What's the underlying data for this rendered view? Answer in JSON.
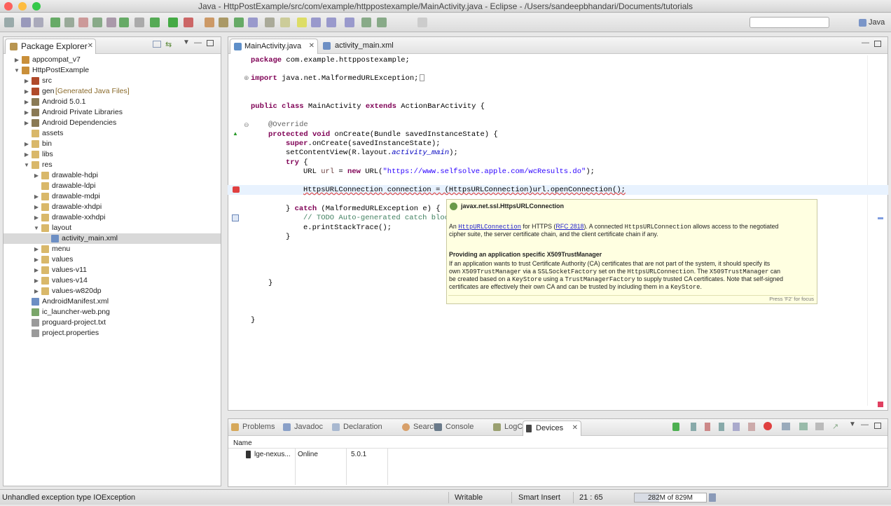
{
  "window": {
    "title": "Java - HttpPostExample/src/com/example/httppostexample/MainActivity.java - Eclipse - /Users/sandeepbhandari/Documents/tutorials"
  },
  "toolbar": {
    "perspective": "Java"
  },
  "package_explorer": {
    "title": "Package Explorer",
    "items": [
      {
        "label": "appcompat_v7",
        "depth": 0,
        "twisty": "▶",
        "icon": "project-icon",
        "color": "#c98f3a"
      },
      {
        "label": "HttpPostExample",
        "depth": 0,
        "twisty": "▼",
        "icon": "project-icon",
        "color": "#c98f3a"
      },
      {
        "label": "src",
        "depth": 1,
        "twisty": "▶",
        "icon": "source-folder-icon",
        "color": "#b04a2a"
      },
      {
        "label": "gen",
        "suffix": " [Generated Java Files]",
        "depth": 1,
        "twisty": "▶",
        "icon": "source-folder-icon",
        "color": "#b04a2a"
      },
      {
        "label": "Android 5.0.1",
        "depth": 1,
        "twisty": "▶",
        "icon": "library-icon",
        "color": "#8a7a55"
      },
      {
        "label": "Android Private Libraries",
        "depth": 1,
        "twisty": "▶",
        "icon": "library-icon",
        "color": "#8a7a55"
      },
      {
        "label": "Android Dependencies",
        "depth": 1,
        "twisty": "▶",
        "icon": "library-icon",
        "color": "#8a7a55"
      },
      {
        "label": "assets",
        "depth": 1,
        "twisty": "",
        "icon": "folder-icon",
        "color": "#d9b86a"
      },
      {
        "label": "bin",
        "depth": 1,
        "twisty": "▶",
        "icon": "folder-icon",
        "color": "#d9b86a"
      },
      {
        "label": "libs",
        "depth": 1,
        "twisty": "▶",
        "icon": "folder-icon",
        "color": "#d9b86a"
      },
      {
        "label": "res",
        "depth": 1,
        "twisty": "▼",
        "icon": "folder-icon",
        "color": "#d9b86a"
      },
      {
        "label": "drawable-hdpi",
        "depth": 2,
        "twisty": "▶",
        "icon": "folder-icon",
        "color": "#d9b86a"
      },
      {
        "label": "drawable-ldpi",
        "depth": 2,
        "twisty": "",
        "icon": "folder-icon",
        "color": "#d9b86a"
      },
      {
        "label": "drawable-mdpi",
        "depth": 2,
        "twisty": "▶",
        "icon": "folder-icon",
        "color": "#d9b86a"
      },
      {
        "label": "drawable-xhdpi",
        "depth": 2,
        "twisty": "▶",
        "icon": "folder-icon",
        "color": "#d9b86a"
      },
      {
        "label": "drawable-xxhdpi",
        "depth": 2,
        "twisty": "▶",
        "icon": "folder-icon",
        "color": "#d9b86a"
      },
      {
        "label": "layout",
        "depth": 2,
        "twisty": "▼",
        "icon": "folder-icon",
        "color": "#d9b86a"
      },
      {
        "label": "activity_main.xml",
        "depth": 3,
        "twisty": "",
        "icon": "xml-file-icon",
        "color": "#6d8fc4",
        "selected": true
      },
      {
        "label": "menu",
        "depth": 2,
        "twisty": "▶",
        "icon": "folder-icon",
        "color": "#d9b86a"
      },
      {
        "label": "values",
        "depth": 2,
        "twisty": "▶",
        "icon": "folder-icon",
        "color": "#d9b86a"
      },
      {
        "label": "values-v11",
        "depth": 2,
        "twisty": "▶",
        "icon": "folder-icon",
        "color": "#d9b86a"
      },
      {
        "label": "values-v14",
        "depth": 2,
        "twisty": "▶",
        "icon": "folder-icon",
        "color": "#d9b86a"
      },
      {
        "label": "values-w820dp",
        "depth": 2,
        "twisty": "▶",
        "icon": "folder-icon",
        "color": "#d9b86a"
      },
      {
        "label": "AndroidManifest.xml",
        "depth": 1,
        "twisty": "",
        "icon": "xml-file-icon",
        "color": "#6d8fc4"
      },
      {
        "label": "ic_launcher-web.png",
        "depth": 1,
        "twisty": "",
        "icon": "image-file-icon",
        "color": "#7aa66a"
      },
      {
        "label": "proguard-project.txt",
        "depth": 1,
        "twisty": "",
        "icon": "text-file-icon",
        "color": "#9a9a9a"
      },
      {
        "label": "project.properties",
        "depth": 1,
        "twisty": "",
        "icon": "text-file-icon",
        "color": "#9a9a9a"
      }
    ]
  },
  "editor": {
    "tabs": [
      "MainActivity.java",
      "activity_main.xml"
    ],
    "code": {
      "package": "package com.example.httppostexample;",
      "import": "import java.net.MalformedURLException;",
      "class_line": [
        "public class ",
        "MainActivity ",
        "extends ",
        "ActionBarActivity {"
      ],
      "override": "@Override",
      "oncreate": [
        "protected void ",
        "onCreate(Bundle savedInstanceState) {"
      ],
      "super": [
        "super",
        ".onCreate(savedInstanceState);"
      ],
      "setcontent": [
        "setContentView(R.layout.",
        "activity_main",
        ");"
      ],
      "try": [
        "try",
        " {"
      ],
      "url": [
        "URL ",
        "url",
        " = ",
        "new ",
        "URL(",
        "\"https://www.selfsolve.apple.com/wcResults.do\"",
        ");"
      ],
      "conn": "HttpsURLConnection connection = (HttpsURLConnection)url.openConnection();",
      "catch": [
        "} ",
        "catch ",
        "(MalformedURLException e) {"
      ],
      "todo": "// TODO Auto-generated catch block",
      "stack": "e.printStackTrace();",
      "brace1": "}",
      "brace2": "}",
      "brace3": "}"
    }
  },
  "tooltip": {
    "title": "javax.net.ssl.HttpsURLConnection",
    "p1_a": "An ",
    "p1_link": "HttpURLConnection",
    "p1_b": " for HTTPS (",
    "p1_rfc": "RFC 2818",
    "p1_c": "). A connected ",
    "p1_mono": "HttpsURLConnection",
    "p1_d": " allows access to the negotiated",
    "p1_e": "cipher suite, the server certificate chain, and the client certificate chain if any.",
    "h2": "Providing an application specific X509TrustManager",
    "p2_l1": "If an application wants to trust Certificate Authority (CA) certificates that are not part of the system, it should specify its",
    "p2_l2a": "own ",
    "p2_l2m1": "X509TrustManager",
    "p2_l2b": " via a ",
    "p2_l2m2": "SSLSocketFactory",
    "p2_l2c": " set on the ",
    "p2_l2m3": "HttpsURLConnection",
    "p2_l2d": ". The ",
    "p2_l2m4": "X509TrustManager",
    "p2_l2e": " can",
    "p2_l3a": "be created based on a ",
    "p2_l3m1": "KeyStore",
    "p2_l3b": " using a ",
    "p2_l3m2": "TrustManagerFactory",
    "p2_l3c": " to supply trusted CA certificates. Note that self-signed",
    "p2_l4a": "certificates are effectively their own CA and can be trusted by including them in a ",
    "p2_l4m": "KeyStore",
    "p2_l4b": ".",
    "footer": "Press 'F2' for focus"
  },
  "bottom_panel": {
    "tabs": [
      "Problems",
      "Javadoc",
      "Declaration",
      "Search",
      "Console",
      "LogCat",
      "Devices"
    ],
    "active_tab": "Devices",
    "column_name": "Name",
    "device": {
      "name": "lge-nexus...",
      "state": "Online",
      "version": "5.0.1"
    }
  },
  "status": {
    "message": "Unhandled exception type IOException",
    "writable": "Writable",
    "insert": "Smart Insert",
    "position": "21 : 65",
    "memory": "282M of 829M"
  }
}
